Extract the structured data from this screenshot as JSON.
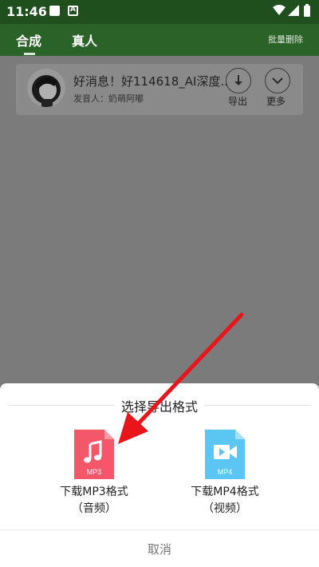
{
  "status_bar": {
    "time": "11:46"
  },
  "app_bar": {
    "tabs": [
      {
        "label": "合成",
        "active": true
      },
      {
        "label": "真人",
        "active": false
      }
    ],
    "batch_delete": "批量删除"
  },
  "record": {
    "title": "好消息！好114618_AI深度...",
    "meta": "发音人：奶萌阿嘟",
    "export_label": "导出",
    "more_label": "更多"
  },
  "sheet": {
    "title": "选择导出格式",
    "options": [
      {
        "icon": "mp3-file-icon",
        "badge": "MP3",
        "line1": "下载MP3格式",
        "line2": "（音频）",
        "color": "#f4566a"
      },
      {
        "icon": "mp4-file-icon",
        "badge": "MP4",
        "line1": "下载MP4格式",
        "line2": "（视频）",
        "color": "#5bc6f2"
      }
    ],
    "cancel": "取消"
  },
  "colors": {
    "accent": "#2a6227",
    "statusbar": "#1f4f1d",
    "annotation_arrow": "#e8151b"
  }
}
